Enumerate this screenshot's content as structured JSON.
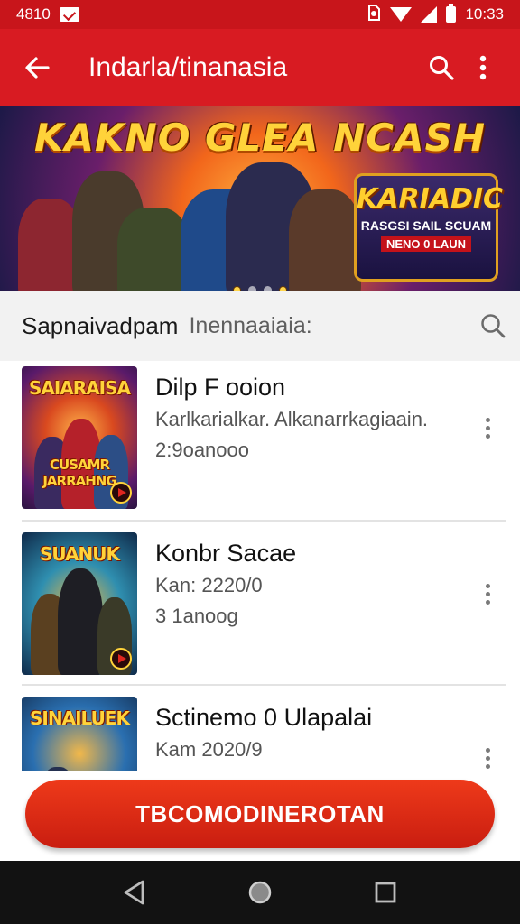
{
  "status_bar": {
    "left_text": "4810",
    "time": "10:33",
    "icons": [
      "notification-icon",
      "sim-icon",
      "wifi-icon",
      "signal-icon",
      "battery-icon"
    ]
  },
  "app_bar": {
    "title": "Indarla/tinanasia",
    "icons": [
      "back-arrow-icon",
      "search-icon",
      "more-vert-icon"
    ]
  },
  "banner": {
    "title": "KAKNO GLEA NCASH",
    "badge_title": "KARIADIC",
    "badge_subtitle": "RASGSI SAIL SCUAM",
    "badge_tag": "NENO 0 LAUN"
  },
  "search": {
    "label": "Sapnaivadpam",
    "placeholder": "Inennaaiaia:"
  },
  "list": {
    "items": [
      {
        "title": "Dilp F ooion",
        "subtitle": "Karlkarialkar. Alkanarrkagiaain.",
        "meta": "2:9oanooo",
        "thumb_title": "SAIARAISA",
        "thumb_caption": "CUSAMR JARRAHNG"
      },
      {
        "title": "Konbr Sacae",
        "subtitle": "Kan: 2220/0",
        "meta": "3 1anoog",
        "thumb_title": "SUANUK",
        "thumb_caption": ""
      },
      {
        "title": "Sctinemo 0 Ulapalai",
        "subtitle": "Kam 2020/9",
        "meta": "",
        "thumb_title": "SINAILUEK",
        "thumb_caption": ""
      }
    ]
  },
  "cta": {
    "label": "TBCOMODINEROTAN"
  },
  "nav_bar": {
    "icons": [
      "back-triangle-icon",
      "home-circle-icon",
      "recents-square-icon"
    ]
  },
  "colors": {
    "primary": "#d81b22",
    "status_bar": "#c8151b",
    "cta": "#e02d16",
    "nav_bar": "#121212"
  }
}
